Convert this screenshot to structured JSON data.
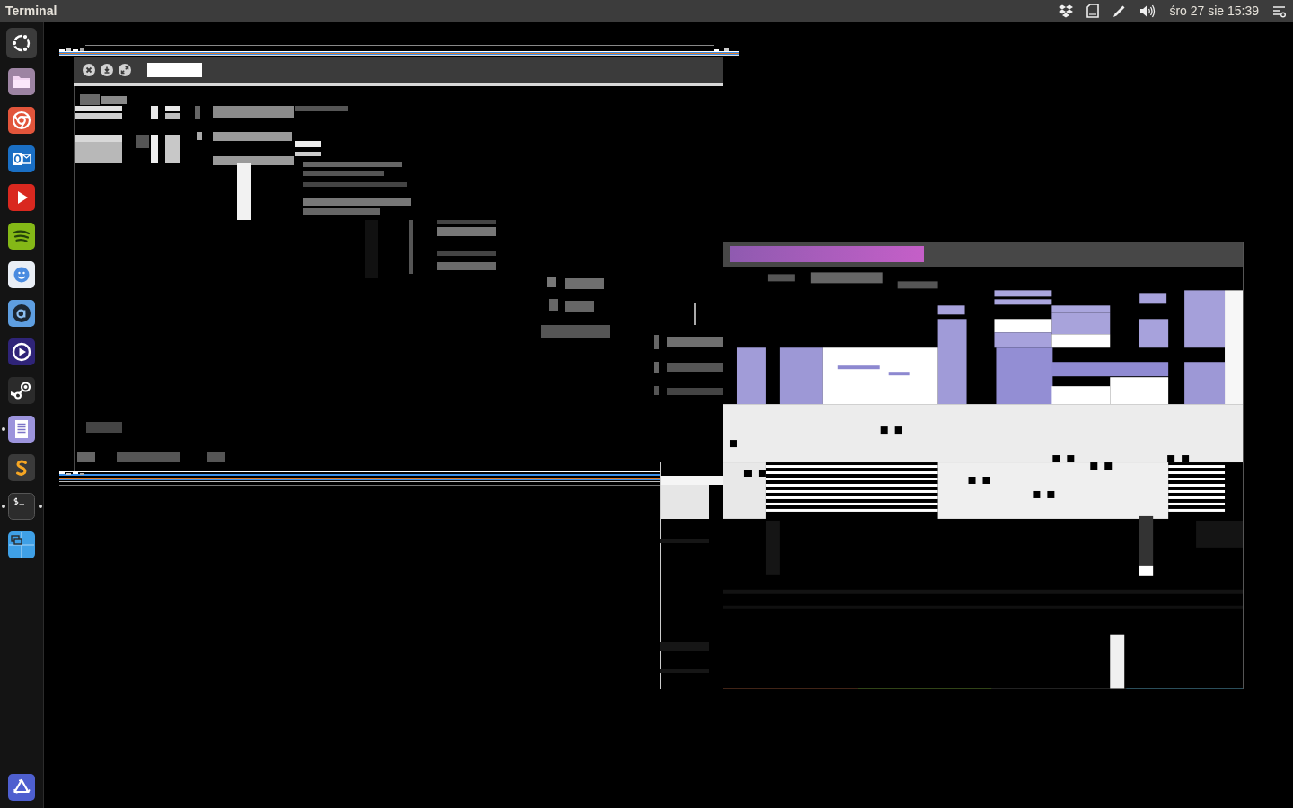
{
  "top_bar": {
    "app_title": "Terminal",
    "clock": "śro 27 sie 15:39"
  },
  "launcher": {
    "items": [
      {
        "kind": "dash",
        "running": false,
        "focused": false
      },
      {
        "kind": "files",
        "running": false,
        "focused": false
      },
      {
        "kind": "browser",
        "running": false,
        "focused": false
      },
      {
        "kind": "mail",
        "running": false,
        "focused": false
      },
      {
        "kind": "video",
        "running": false,
        "focused": false
      },
      {
        "kind": "music",
        "running": false,
        "focused": false
      },
      {
        "kind": "chat",
        "running": false,
        "focused": false
      },
      {
        "kind": "store",
        "running": false,
        "focused": false
      },
      {
        "kind": "player",
        "running": false,
        "focused": false
      },
      {
        "kind": "games",
        "running": false,
        "focused": false
      },
      {
        "kind": "document",
        "running": true,
        "focused": false
      },
      {
        "kind": "editor",
        "running": false,
        "focused": false
      },
      {
        "kind": "terminal",
        "running": true,
        "focused": true
      },
      {
        "kind": "workspaces",
        "running": false,
        "focused": false
      },
      {
        "kind": "trash",
        "running": false,
        "focused": false
      }
    ]
  }
}
